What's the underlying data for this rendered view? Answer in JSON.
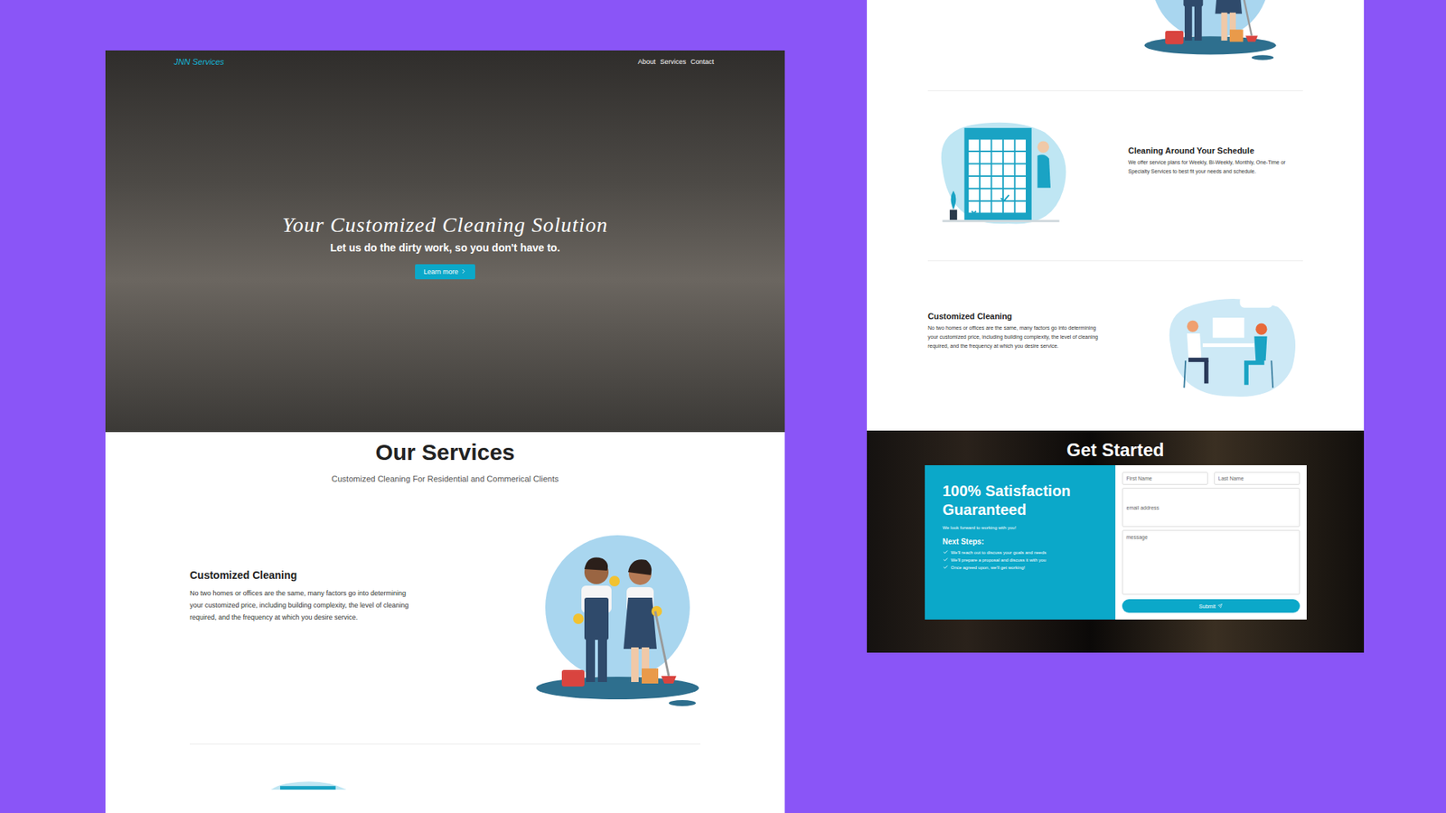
{
  "left_page": {
    "nav": {
      "logo": "JNN Services",
      "links": [
        "About",
        "Services",
        "Contact"
      ]
    },
    "hero": {
      "title": "Your Customized Cleaning Solution",
      "subtitle": "Let us do the dirty work, so you don't have to.",
      "button": "Learn more"
    },
    "services": {
      "title": "Our Services",
      "subtitle": "Customized Cleaning For Residential and Commerical Clients",
      "items": [
        {
          "kind": "cleaners",
          "title": "Customized Cleaning",
          "text": "No two homes or offices are the same, many factors go into determining your customized price, including building complexity, the level of cleaning required, and the frequency at which you desire service."
        }
      ]
    }
  },
  "right_page": {
    "services": {
      "items": [
        {
          "kind": "calendar",
          "title": "Cleaning Around Your Schedule",
          "text": "We offer service plans for Weekly, Bi-Weekly, Monthly, One-Time or Specialty Services to best fit your needs and schedule."
        },
        {
          "kind": "meeting",
          "title": "Customized Cleaning",
          "text": "No two homes or offices are the same, many factors go into determining your customized price, including building complexity, the level of cleaning required, and the frequency at which you desire service."
        }
      ]
    },
    "get_started": {
      "title": "Get Started",
      "card_title": "100% Satisfaction Guaranteed",
      "intro": "We look forward to working with you!",
      "steps_title": "Next Steps:",
      "steps": [
        "We'll reach out to discuss your goals and needs",
        "We'll prepare a proposal and discuss it with you",
        "Once agreed upon, we'll get working!"
      ],
      "form": {
        "first_name": "First Name",
        "last_name": "Last Name",
        "email": "email address",
        "message": "message",
        "submit": "Submit"
      }
    }
  }
}
